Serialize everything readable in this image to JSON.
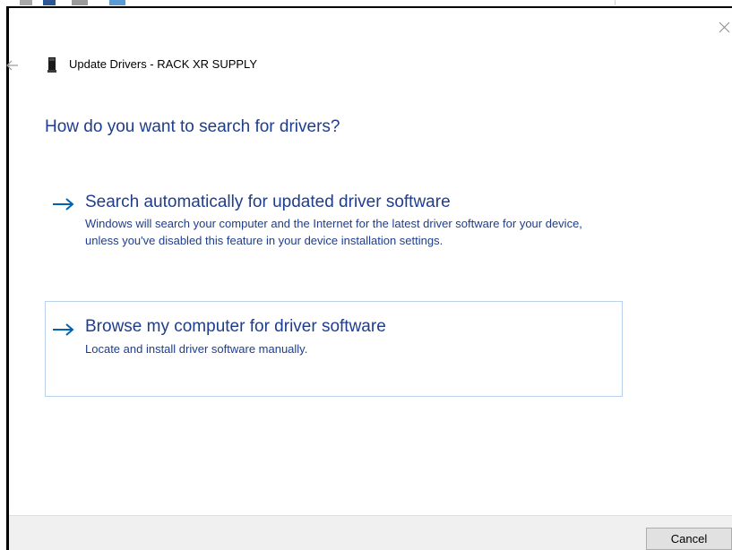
{
  "window": {
    "title": "Update Drivers - RACK XR SUPPLY"
  },
  "icons": {
    "close": "close-icon",
    "back": "back-arrow-icon",
    "device": "device-icon",
    "option_arrow": "right-arrow-icon"
  },
  "question": "How do you want to search for drivers?",
  "options": [
    {
      "title": "Search automatically for updated driver software",
      "description": "Windows will search your computer and the Internet for the latest driver software for your device, unless you've disabled this feature in your device installation settings."
    },
    {
      "title": "Browse my computer for driver software",
      "description": "Locate and install driver software manually."
    }
  ],
  "footer": {
    "cancel_label": "Cancel"
  },
  "colors": {
    "heading_blue": "#1e3d8c",
    "arrow_blue": "#0063b1",
    "option_border": "#b9d1ea",
    "footer_bg": "#f0f0f0"
  }
}
